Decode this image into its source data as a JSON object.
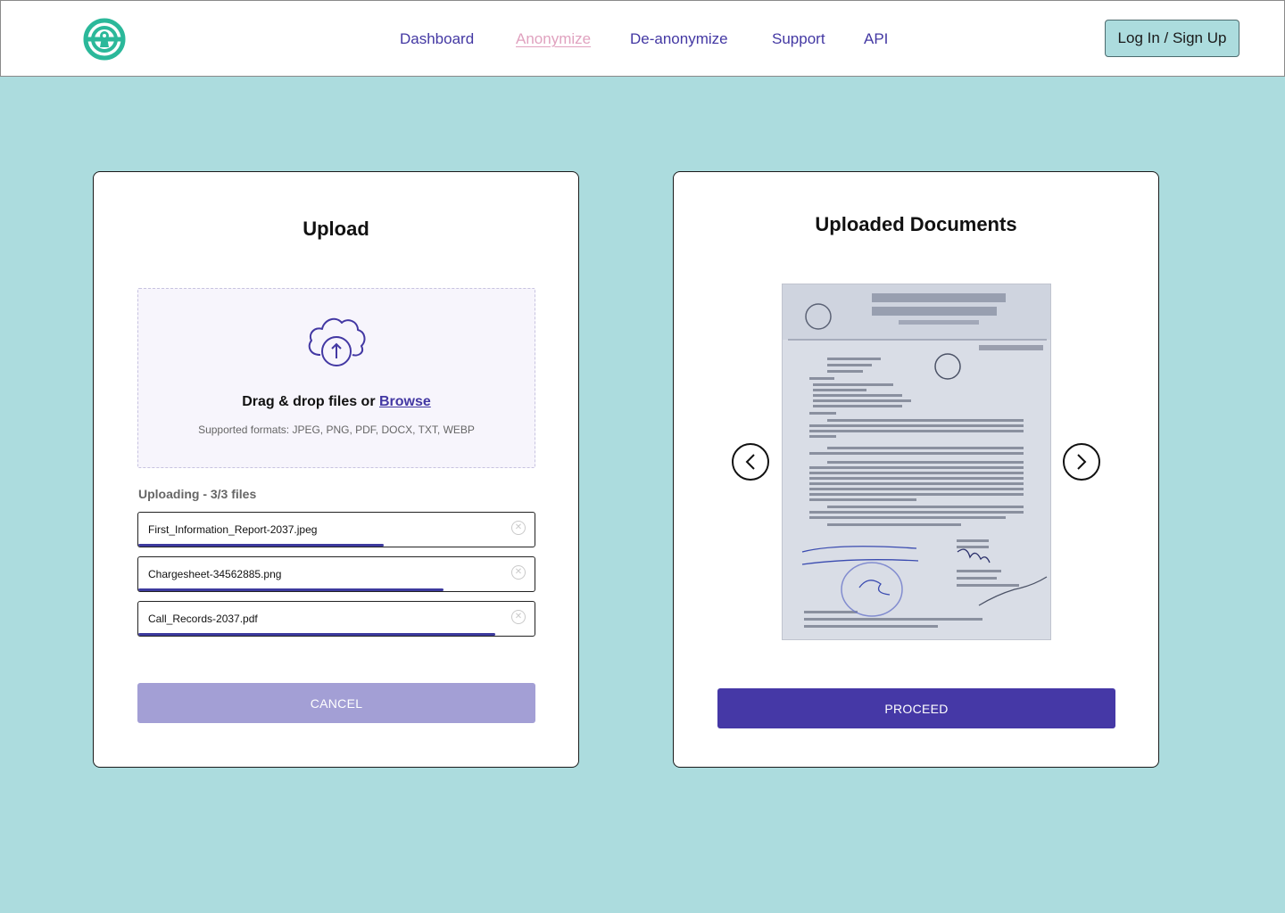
{
  "header": {
    "logo_icon": "shield-keyhole-logo",
    "nav": [
      {
        "label": "Dashboard",
        "active": false
      },
      {
        "label": "Anonymize",
        "active": true
      },
      {
        "label": "De-anonymize",
        "active": false
      },
      {
        "label": "Support",
        "active": false
      },
      {
        "label": "API",
        "active": false
      }
    ],
    "login_label": "Log In / Sign Up"
  },
  "upload": {
    "title": "Upload",
    "cloud_icon": "cloud-upload-icon",
    "drag_text": "Drag & drop files or ",
    "browse_label": "Browse",
    "formats": "Supported formats: JPEG, PNG, PDF, DOCX, TXT, WEBP",
    "uploading_label": "Uploading - 3/3 files",
    "files": [
      {
        "name": "First_Information_Report-2037.jpeg",
        "progress": 0.62
      },
      {
        "name": "Chargesheet-34562885.png",
        "progress": 0.77
      },
      {
        "name": "Call_Records-2037.pdf",
        "progress": 0.9
      }
    ],
    "cancel_label": "CANCEL"
  },
  "documents": {
    "title": "Uploaded Documents",
    "preview_icon": "scanned-document-image",
    "prev_icon": "chevron-left-icon",
    "next_icon": "chevron-right-icon",
    "proceed_label": "PROCEED"
  },
  "colors": {
    "background": "#acdcde",
    "primary": "#4538a6",
    "active_nav": "#e0a2bf",
    "cancel": "#a39fd5",
    "logo": "#2bb89a"
  }
}
